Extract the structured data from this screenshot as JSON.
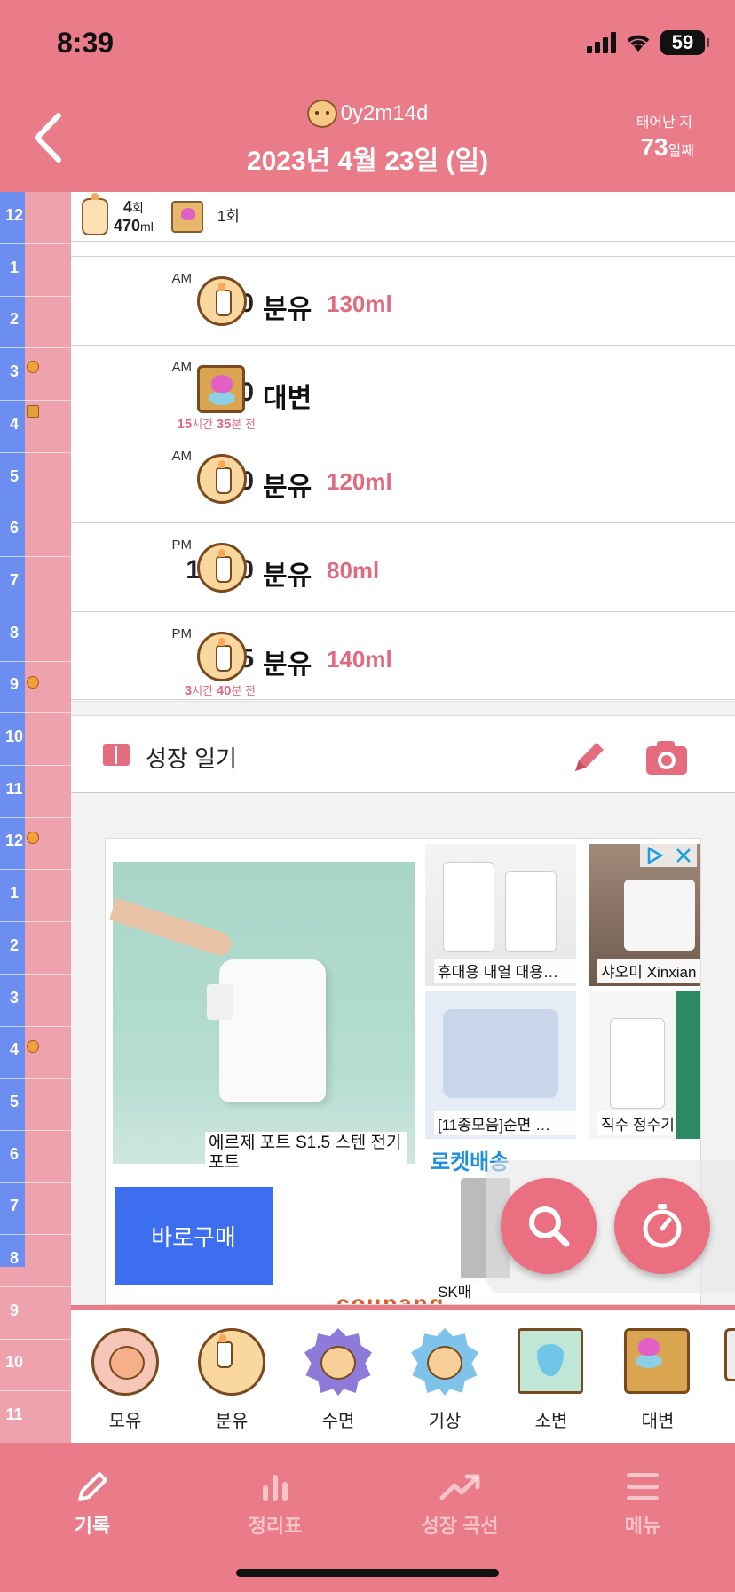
{
  "status_bar": {
    "time": "8:39",
    "battery": "59"
  },
  "header": {
    "age": "0y2m14d",
    "date": "2023년 4월 23일 (일)",
    "born_label": "태어난 지",
    "born_days": "73",
    "born_days_unit": "일째"
  },
  "timeline": {
    "hours": [
      "12",
      "1",
      "2",
      "3",
      "4",
      "5",
      "6",
      "7",
      "8",
      "9",
      "10",
      "11",
      "12",
      "1",
      "2",
      "3",
      "4",
      "5",
      "6",
      "7",
      "8",
      "9",
      "10",
      "11"
    ]
  },
  "summary": {
    "feed_count": "4",
    "feed_count_unit": "회",
    "feed_total": "470",
    "feed_total_unit": "ml",
    "poop_count": "1회"
  },
  "entries": [
    {
      "ampm": "AM",
      "time": "4:20",
      "type": "분유",
      "amount": "130ml",
      "ago_h": "",
      "ago_h_unit": "",
      "ago_m": "",
      "ago_m_unit": "",
      "ago_suffix": ""
    },
    {
      "ampm": "AM",
      "time": "5:00",
      "type": "대변",
      "amount": "",
      "ago_h": "15",
      "ago_h_unit": "시간 ",
      "ago_m": "35",
      "ago_m_unit": "분 ",
      "ago_suffix": "전"
    },
    {
      "ampm": "AM",
      "time": "9:40",
      "type": "분유",
      "amount": "120ml",
      "ago_h": "",
      "ago_h_unit": "",
      "ago_m": "",
      "ago_m_unit": "",
      "ago_suffix": ""
    },
    {
      "ampm": "PM",
      "time": "12:40",
      "type": "분유",
      "amount": "80ml",
      "ago_h": "",
      "ago_h_unit": "",
      "ago_m": "",
      "ago_m_unit": "",
      "ago_suffix": ""
    },
    {
      "ampm": "PM",
      "time": "4:55",
      "type": "분유",
      "amount": "140ml",
      "ago_h": "3",
      "ago_h_unit": "시간 ",
      "ago_m": "40",
      "ago_m_unit": "분 ",
      "ago_suffix": "전"
    }
  ],
  "diary": {
    "title": "성장 일기"
  },
  "ad": {
    "main_caption": "에르제 포트 S1.5 스텐 전기포트",
    "buy_label": "바로구매",
    "thumb1": "휴대용 내열 대용…",
    "thumb2": "샤오미 Xinxian",
    "thumb3": "[11종모음]순면 …",
    "thumb4": "직수 정수기 휴",
    "thumb5": "SK매",
    "rocket": "로켓배송",
    "brand": "coupang"
  },
  "quick_add": [
    {
      "label": "모유",
      "icon": "breastfeed-icon"
    },
    {
      "label": "분유",
      "icon": "bottle-icon"
    },
    {
      "label": "수면",
      "icon": "sleep-icon"
    },
    {
      "label": "기상",
      "icon": "wake-icon"
    },
    {
      "label": "소변",
      "icon": "pee-icon"
    },
    {
      "label": "대변",
      "icon": "poop-icon"
    }
  ],
  "tabs": [
    {
      "label": "기록",
      "active": true
    },
    {
      "label": "정리표",
      "active": false
    },
    {
      "label": "성장 곡선",
      "active": false
    },
    {
      "label": "메뉴",
      "active": false
    }
  ],
  "colors": {
    "header": "#ea7b88",
    "accent": "#e06b80",
    "timeline_blue": "#6c8ef0",
    "timeline_pink": "#eda2ad",
    "buy_button": "#3d6ef0"
  }
}
